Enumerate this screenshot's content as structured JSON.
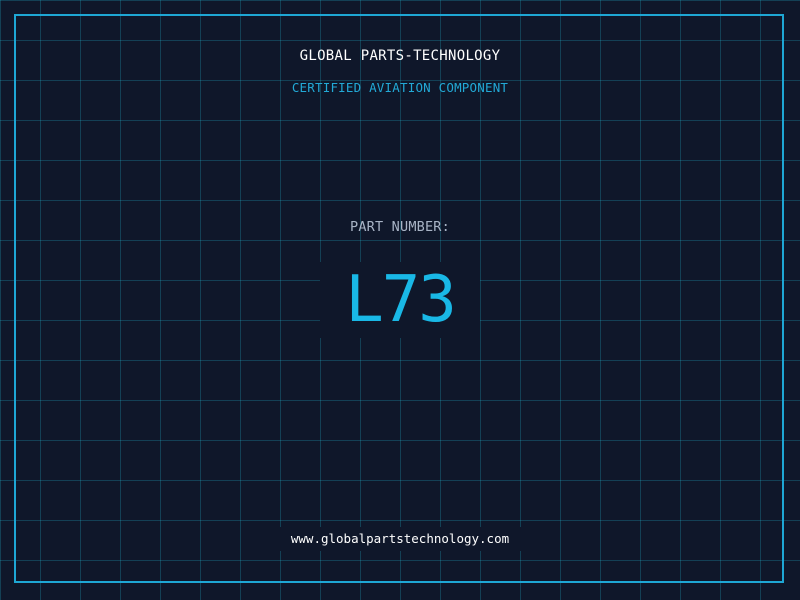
{
  "header": {
    "company": "GLOBAL PARTS-TECHNOLOGY",
    "subtitle": "CERTIFIED AVIATION COMPONENT"
  },
  "part": {
    "label": "PART NUMBER:",
    "number": "L73"
  },
  "footer": {
    "url": "www.globalpartstechnology.com"
  },
  "colors": {
    "background": "#0f172a",
    "grid": "#22d3ee",
    "frame": "#1ea7d4",
    "accent": "#19b8e6",
    "label": "#a9b4c6",
    "text": "#ffffff"
  }
}
